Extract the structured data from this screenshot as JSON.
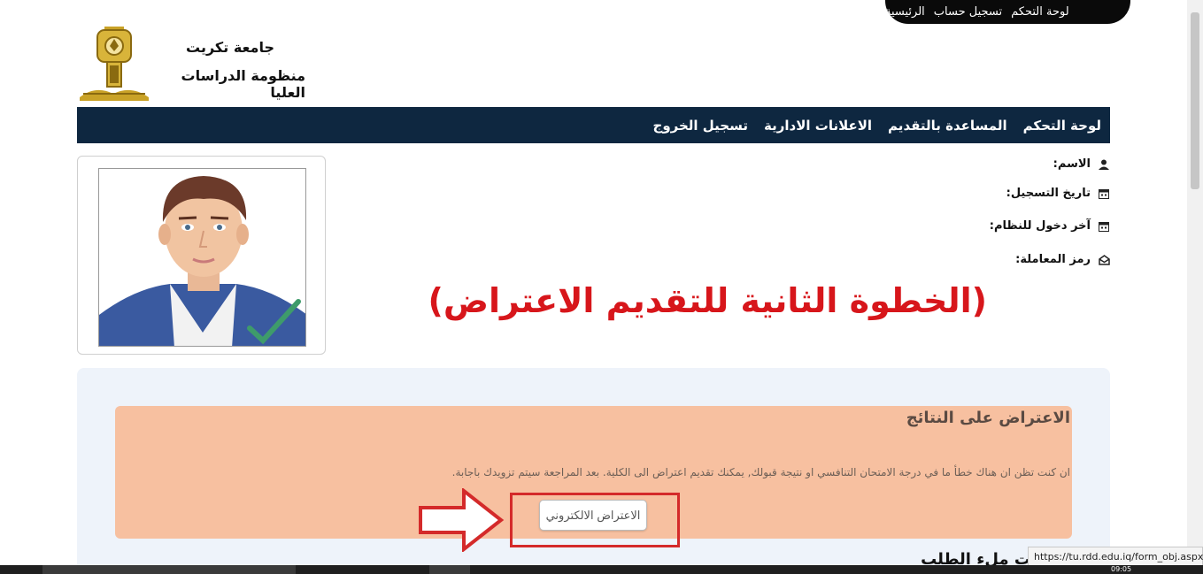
{
  "top_nav": {
    "items": [
      "لوحة التحكم",
      "تسجيل حساب",
      "الرئيسية"
    ]
  },
  "header": {
    "university_name": "جامعة تكريت",
    "system_name": "منظومة الدراسات العليا"
  },
  "main_nav": {
    "items": [
      "لوحة التحكم",
      "المساعدة بالتقديم",
      "الاعلانات الادارية",
      "تسجيل الخروج"
    ]
  },
  "profile": {
    "name_label": "الاسم:",
    "registration_date_label": "تاريخ التسجيل:",
    "last_login_label": "آخر دخول للنظام:",
    "transaction_code_label": "رمز المعاملة:"
  },
  "annotation": {
    "step_title": "(الخطوة الثانية للتقديم الاعتراض)"
  },
  "objection": {
    "title": "الاعتراض على النتائج",
    "description": "ان كنت تظن ان هناك خطأ ما في درجة الامتحان التنافسي او نتيجة قبولك, يمكنك تقديم اعتراض الى الكلية. بعد المراجعة سيتم تزويدك باجابة.",
    "button_label": "الاعتراض الالكتروني"
  },
  "next_section": {
    "heading_partial": "ت ملء الطلب"
  },
  "status_bar": {
    "url": "https://tu.rdd.edu.iq/form_obj.aspx"
  },
  "taskbar": {
    "clock": "09:05"
  },
  "colors": {
    "nav_bg": "#0e2740",
    "card_bg": "#f7c0a0",
    "panel_bg": "#eef3fa",
    "annotation_red": "#d7161b"
  }
}
